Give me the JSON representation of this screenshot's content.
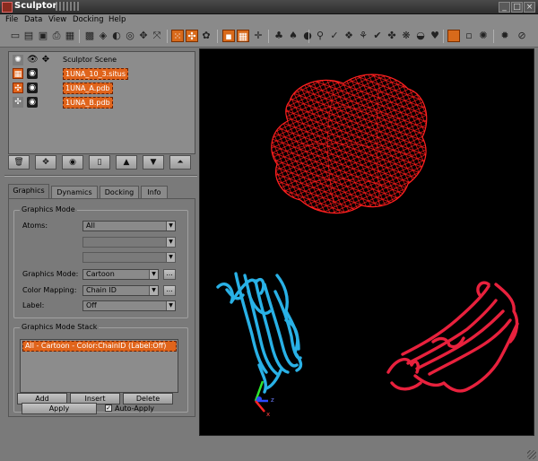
{
  "window": {
    "title": "Sculptor",
    "controls": [
      "min-icon",
      "max-icon",
      "close-icon"
    ]
  },
  "menu": [
    "File",
    "Data",
    "View",
    "Docking",
    "Help"
  ],
  "toolbar": {
    "icons": [
      "new-icon",
      "open-icon",
      "save-icon",
      "print-icon",
      "export-icon",
      "screenshot-icon",
      "zoom-icon",
      "contrast-icon",
      "rotate-icon",
      "fit-icon",
      "atoms-icon",
      "molecule-icon",
      "volume-icon",
      "orange-square-icon",
      "mesh-icon",
      "axis-icon",
      "people-icon",
      "fruit-icon",
      "wind-icon",
      "arrow-icon",
      "link-icon",
      "duck-icon",
      "orange-box-icon",
      "gray-square-icon",
      "sun-icon",
      "settings-icon",
      "stop-icon"
    ]
  },
  "scene": {
    "header": "Sculptor Scene",
    "items": [
      {
        "name": "1UNA_10_3.situs",
        "selected": true
      },
      {
        "name": "1UNA_A.pdb",
        "selected": true
      },
      {
        "name": "1UNA_B.pdb",
        "selected": true
      }
    ],
    "buttons": [
      "delete-icon",
      "move-icon",
      "visible-icon",
      "document-icon",
      "up-icon",
      "down-icon",
      "top-icon"
    ]
  },
  "tabs": [
    "Graphics",
    "Dynamics",
    "Docking",
    "Info"
  ],
  "graphics_mode": {
    "title": "Graphics Mode",
    "atoms_label": "Atoms:",
    "atoms_value": "All",
    "mode_label": "Graphics Mode:",
    "mode_value": "Cartoon",
    "color_label": "Color Mapping:",
    "color_value": "Chain ID",
    "label_label": "Label:",
    "label_value": "Off",
    "dots": "..."
  },
  "stack": {
    "title": "Graphics Mode Stack",
    "items": [
      "All - Cartoon - Color:ChainID (Label:Off)"
    ],
    "add": "Add",
    "insert": "Insert",
    "delete": "Delete",
    "apply": "Apply",
    "auto_apply": "Auto-Apply",
    "auto_apply_checked": true
  },
  "viewport": {
    "background": "#000000",
    "density_map_color": "#ff1010",
    "chain_a_color": "#29b1e6",
    "chain_b_color": "#e8213d",
    "axes": [
      "z",
      "x"
    ]
  }
}
